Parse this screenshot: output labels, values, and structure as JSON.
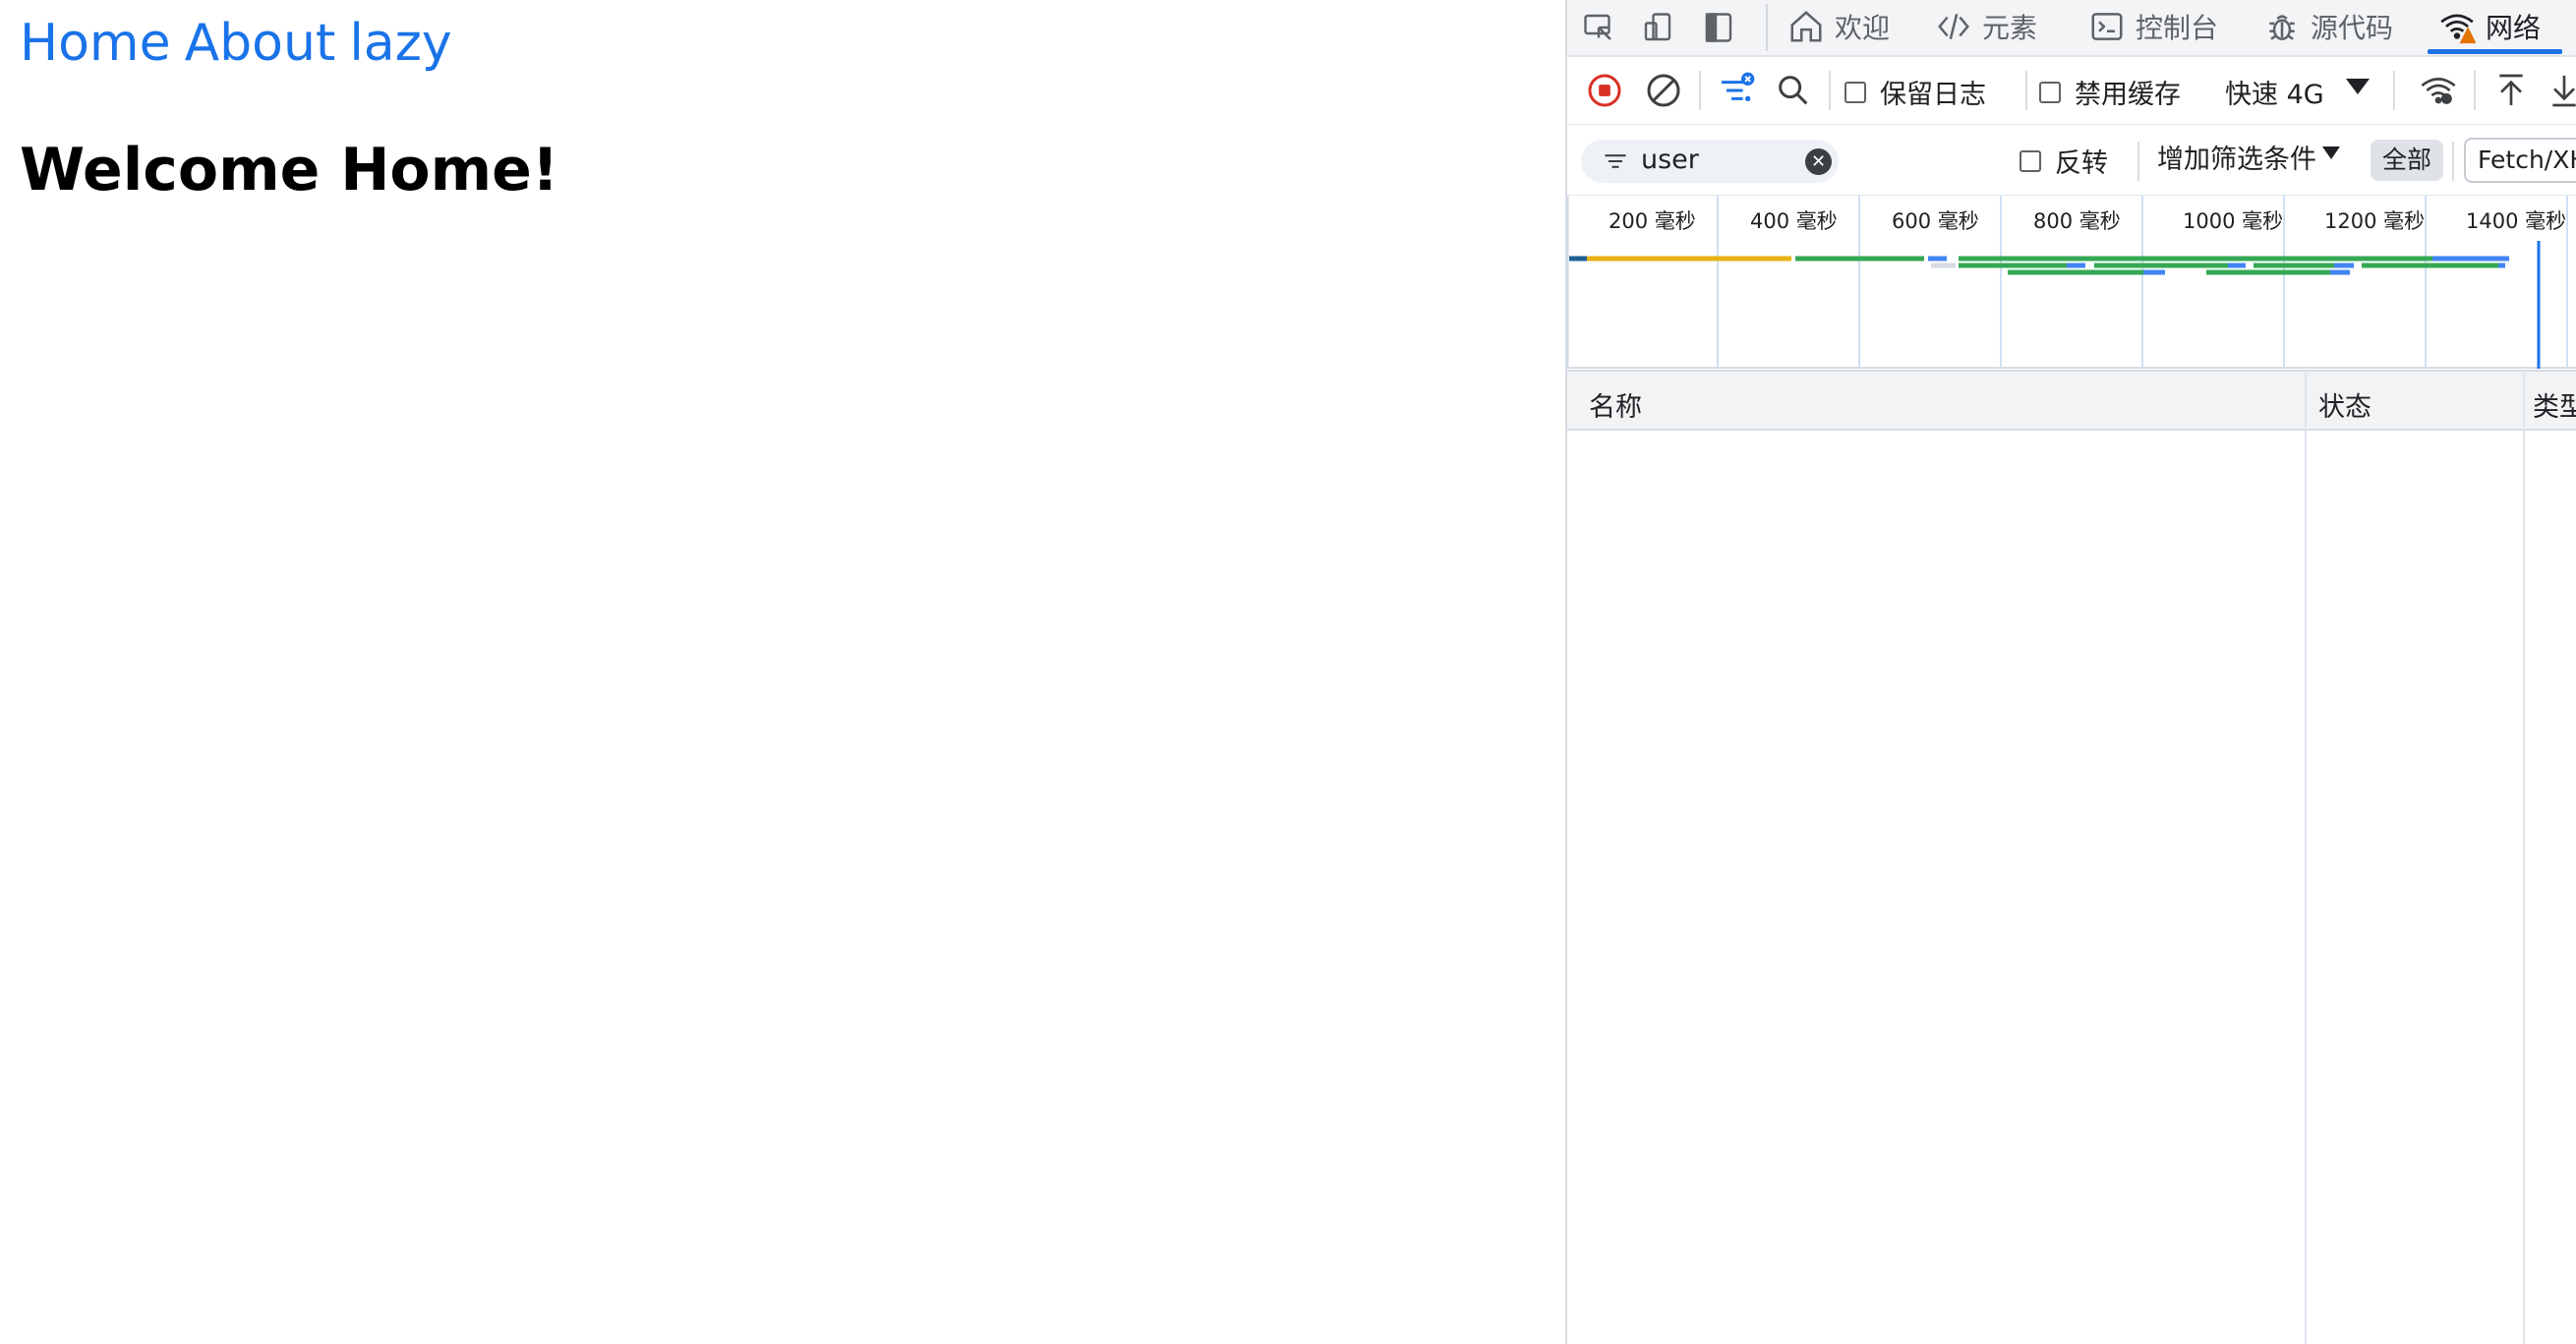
{
  "page": {
    "nav": [
      "Home",
      "About",
      "lazy"
    ],
    "heading": "Welcome Home!"
  },
  "devtools": {
    "tabs": [
      "欢迎",
      "元素",
      "控制台",
      "源代码",
      "网络"
    ],
    "active_tab": "网络",
    "toolbar": {
      "preserve_log": "保留日志",
      "disable_cache": "禁用缓存",
      "throttling": "快速 4G"
    },
    "filter": {
      "value": "user",
      "invert": "反转",
      "more_filters": "增加筛选条件",
      "type_all": "全部",
      "type_fetch": "Fetch/XH"
    },
    "timeline": {
      "ticks": [
        "200  毫秒",
        "400  毫秒",
        "600  毫秒",
        "800  毫秒",
        "1000  毫秒",
        "1200  毫秒",
        "1400  毫秒"
      ]
    },
    "columns": [
      "名称",
      "状态",
      "类型"
    ]
  },
  "colors": {
    "link": "#1a73e8",
    "record": "#d93025",
    "accent": "#1a73e8",
    "waiting": "#e8b114",
    "download": "#34a853",
    "request": "#4285f4"
  }
}
